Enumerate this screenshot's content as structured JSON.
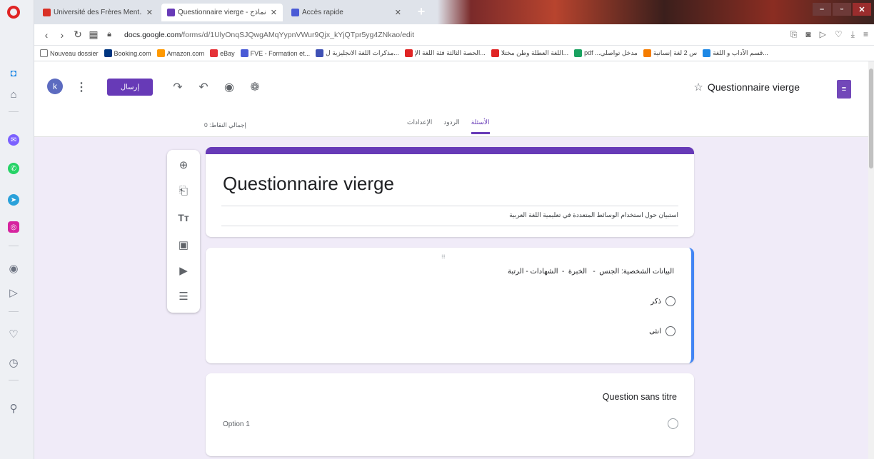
{
  "browser": {
    "tabs": [
      {
        "title": "Université des Frères Ment...",
        "color": "#d93025"
      },
      {
        "title": "Questionnaire vierge - نماذج",
        "color": "#673ab7"
      },
      {
        "title": "Accès rapide",
        "color": "#4a5bd6"
      }
    ],
    "url_host": "docs.google.com",
    "url_path": "/forms/d/1UlyOnqSJQwgAMqYypnVWur9Qjx_kYjQTpr5yg4ZNkao/edit",
    "bookmarks": [
      {
        "label": "Nouveau dossier",
        "color": "#777777"
      },
      {
        "label": "Booking.com",
        "color": "#003580"
      },
      {
        "label": "Amazon.com",
        "color": "#ff9900"
      },
      {
        "label": "eBay",
        "color": "#e53238"
      },
      {
        "label": "FVE - Formation et...",
        "color": "#4a5bd6"
      },
      {
        "label": "مذكرات اللغة الانجليزية ل...",
        "color": "#3f51b5"
      },
      {
        "label": "الحصة الثالثة فئة اللغة الإ...",
        "color": "#e02424"
      },
      {
        "label": "اللغة العطلة وطن مختلا...",
        "color": "#e02424"
      },
      {
        "label": "pdf ...مدخل تواصلي",
        "color": "#1aa260"
      },
      {
        "label": "س 2 لغة إنسانية",
        "color": "#f57c00"
      },
      {
        "label": "قسم الآداب و اللغة...",
        "color": "#1e88e5"
      }
    ]
  },
  "header": {
    "avatar_letter": "k",
    "send_label": "إرسال",
    "title": "Questionnaire vierge",
    "points_label": "إجمالي النقاط: 0",
    "tabs": [
      "الأسئلة",
      "الردود",
      "الإعدادات"
    ]
  },
  "form": {
    "title": "Questionnaire vierge",
    "description": "استبيان حول استخدام الوسائط المتعددة في تعليمية اللغة العربية"
  },
  "question1": {
    "title": "البيانات الشخصية: الجنس  -   الخبرة  -  الشهادات - الرتبة",
    "options": [
      "ذكر",
      "انثى"
    ]
  },
  "question2": {
    "title": "Question sans titre",
    "option": "Option 1"
  },
  "colors": {
    "accent": "#673ab7",
    "focus": "#4285f4",
    "background": "#f0ebf8"
  }
}
